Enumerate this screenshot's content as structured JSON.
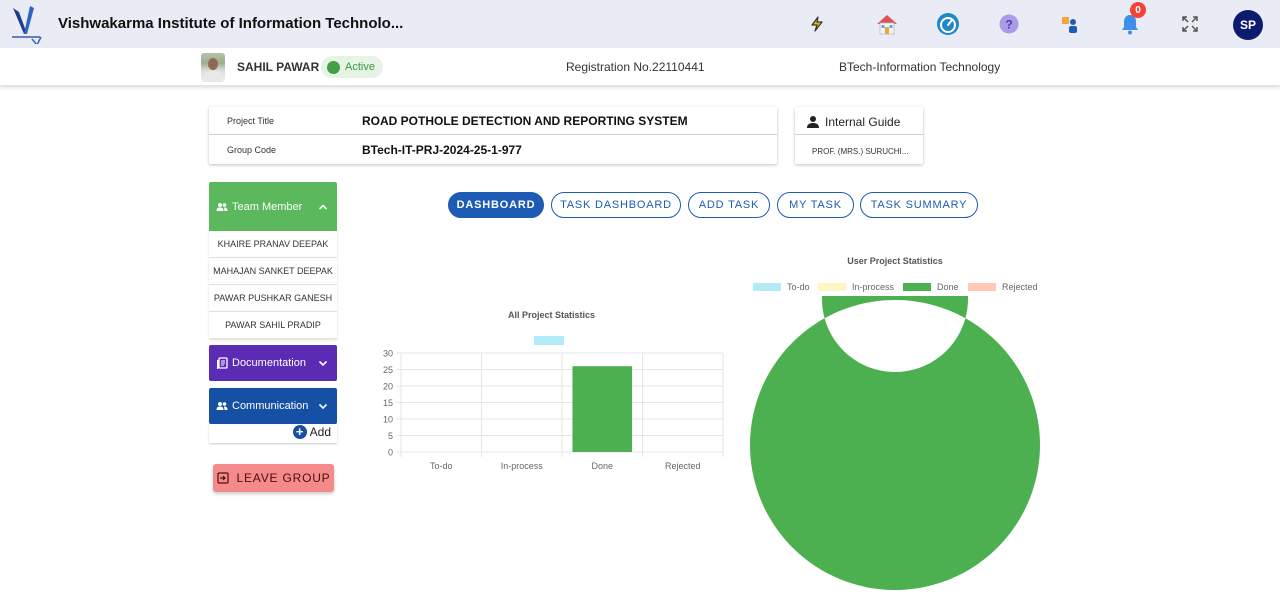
{
  "header": {
    "title": "Vishwakarma Institute of Information Technolo...",
    "icons": [
      "lightning-icon",
      "home-icon",
      "dashboard-gauge-icon",
      "help-icon",
      "user-switch-icon",
      "bell-icon",
      "fullscreen-icon"
    ],
    "notification_count": "0",
    "avatar_initials": "SP"
  },
  "student": {
    "name": "SAHIL PAWAR",
    "status": "Active",
    "registration": "Registration No.22110441",
    "branch": "BTech-Information Technology"
  },
  "project": {
    "title_label": "Project Title",
    "title_value": "ROAD POTHOLE DETECTION AND REPORTING SYSTEM",
    "code_label": "Group Code",
    "code_value": "BTech-IT-PRJ-2024-25-1-977"
  },
  "guide": {
    "label": "Internal Guide",
    "name": "PROF. (MRS.) SURUCHI..."
  },
  "sidebar": {
    "team_label": "Team Member",
    "members": [
      "KHAIRE PRANAV DEEPAK",
      "MAHAJAN SANKET DEEPAK",
      "PAWAR PUSHKAR GANESH",
      "PAWAR SAHIL PRADIP"
    ],
    "documentation_label": "Documentation",
    "communication_label": "Communication",
    "add_label": "Add",
    "leave_label": "LEAVE GROUP"
  },
  "tabs": [
    "DASHBOARD",
    "TASK DASHBOARD",
    "ADD TASK",
    "MY TASK",
    "TASK SUMMARY"
  ],
  "colors": {
    "todo": "#b3ecf8",
    "inprocess": "#fff6c2",
    "done": "#4caf50",
    "rejected": "#ffc8b8",
    "accent": "#1e5bb5"
  },
  "chart_data": [
    {
      "type": "bar",
      "title": "All Project Statistics",
      "categories": [
        "To-do",
        "In-process",
        "Done",
        "Rejected"
      ],
      "values": [
        0,
        0,
        26,
        0
      ],
      "yticks": [
        "0",
        "5",
        "10",
        "15",
        "20",
        "25",
        "30"
      ],
      "ylim": [
        0,
        30
      ],
      "grid": true,
      "legend": "top-center"
    },
    {
      "type": "pie",
      "title": "User Project Statistics",
      "labels": [
        "To-do",
        "In-process",
        "Done",
        "Rejected"
      ],
      "values": [
        0,
        0,
        1,
        0
      ],
      "legend": "top"
    }
  ]
}
